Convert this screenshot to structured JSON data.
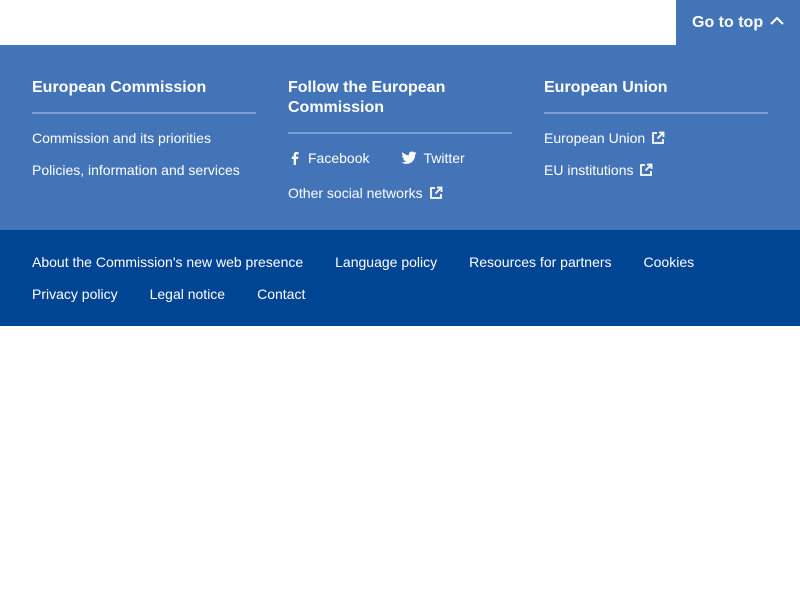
{
  "go_top": {
    "label": "Go to top"
  },
  "columns": {
    "commission": {
      "title": "European Commission",
      "links": [
        "Commission and its priorities",
        "Policies, information and services"
      ]
    },
    "follow": {
      "title": "Follow the European Commission",
      "facebook": "Facebook",
      "twitter": "Twitter",
      "other": "Other social networks"
    },
    "eu": {
      "title": "European Union",
      "links": [
        "European Union",
        "EU institutions"
      ]
    }
  },
  "bottom": {
    "row1": [
      "About the Commission's new web presence",
      "Language policy",
      "Resources for partners",
      "Cookies"
    ],
    "row2": [
      "Privacy policy",
      "Legal notice",
      "Contact"
    ]
  },
  "colors": {
    "footer_top": "#4374b7",
    "footer_bottom": "#004494",
    "divider": "#7d9fd1"
  },
  "icons": {
    "go_top": "chevron-up-icon",
    "facebook": "facebook-icon",
    "twitter": "twitter-icon",
    "external": "external-link-icon"
  }
}
